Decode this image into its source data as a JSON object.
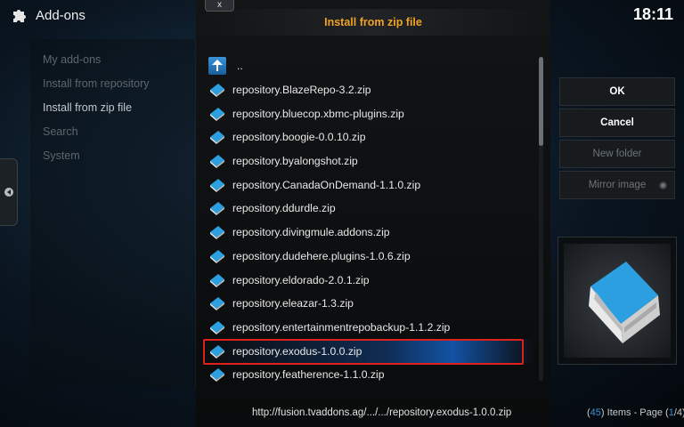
{
  "header": {
    "title": "Add-ons",
    "clock": "18:11"
  },
  "sidebar": {
    "items": [
      {
        "label": "My add-ons"
      },
      {
        "label": "Install from repository"
      },
      {
        "label": "Install from zip file"
      },
      {
        "label": "Search"
      },
      {
        "label": "System"
      }
    ],
    "active_index": 2
  },
  "dialog": {
    "title": "Install from zip file",
    "close_label": "x",
    "parent_label": "..",
    "files": [
      "repository.BlazeRepo-3.2.zip",
      "repository.bluecop.xbmc-plugins.zip",
      "repository.boogie-0.0.10.zip",
      "repository.byalongshot.zip",
      "repository.CanadaOnDemand-1.1.0.zip",
      "repository.ddurdle.zip",
      "repository.divingmule.addons.zip",
      "repository.dudehere.plugins-1.0.6.zip",
      "repository.eldorado-2.0.1.zip",
      "repository.eleazar-1.3.zip",
      "repository.entertainmentrepobackup-1.1.2.zip",
      "repository.exodus-1.0.0.zip",
      "repository.featherence-1.1.0.zip"
    ],
    "selected_file_index": 11,
    "path": "http://fusion.tvaddons.ag/.../.../repository.exodus-1.0.0.zip"
  },
  "buttons": {
    "ok": "OK",
    "cancel": "Cancel",
    "new_folder": "New folder",
    "mirror_image": "Mirror image"
  },
  "footer": {
    "items_open": "(",
    "items_count": "45",
    "items_mid": ") Items - Page (",
    "page_current": "1",
    "page_sep": "/",
    "page_total": "4",
    "items_close": ")"
  },
  "colors": {
    "accent_orange": "#f0a224",
    "accent_blue": "#3a90d8",
    "highlight_red": "#e0201b"
  },
  "icons": {
    "header": "puzzle-icon",
    "file": "book-icon",
    "parent": "up-arrow-icon"
  }
}
